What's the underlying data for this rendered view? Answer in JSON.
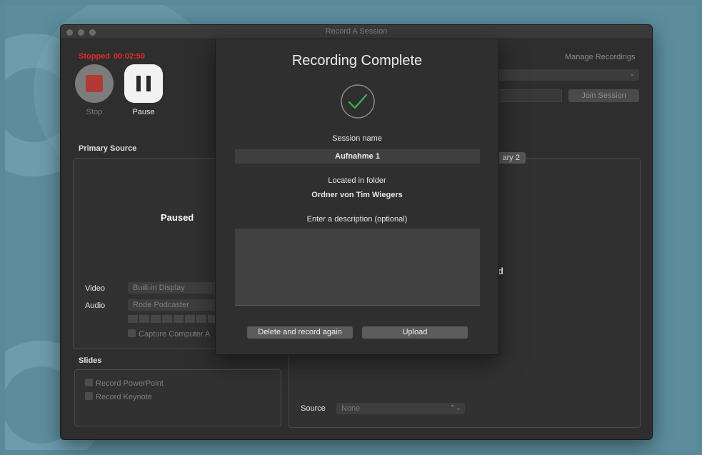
{
  "window": {
    "title": "Record A Session"
  },
  "status": {
    "state": "Stopped",
    "time": "00:02:59"
  },
  "controls": {
    "stop_label": "Stop",
    "pause_label": "Pause"
  },
  "top_right": {
    "manage_recordings": "Manage Recordings",
    "join_session": "Join Session"
  },
  "primary_source": {
    "heading": "Primary Source",
    "preview_text": "Paused",
    "video_label": "Video",
    "video_value": "Built-in Display",
    "audio_label": "Audio",
    "audio_value": "Rode Podcaster",
    "capture_label": "Capture Computer A"
  },
  "secondary": {
    "tab_label": "ary 2",
    "preview_text": "d"
  },
  "slides": {
    "heading": "Slides",
    "powerpoint": "Record PowerPoint",
    "keynote": "Record Keynote"
  },
  "source": {
    "label": "Source",
    "value": "None"
  },
  "sheet": {
    "title": "Recording Complete",
    "session_name_label": "Session name",
    "session_name_value": "Aufnahme 1",
    "folder_label": "Located in folder",
    "folder_value": "Ordner von Tim Wiegers",
    "description_label": "Enter a description (optional)",
    "description_value": "",
    "delete_button": "Delete and record again",
    "upload_button": "Upload"
  },
  "colors": {
    "stopped_red": "#e22a2a",
    "check_green": "#3bbd4a",
    "stop_square": "#b23a34"
  }
}
